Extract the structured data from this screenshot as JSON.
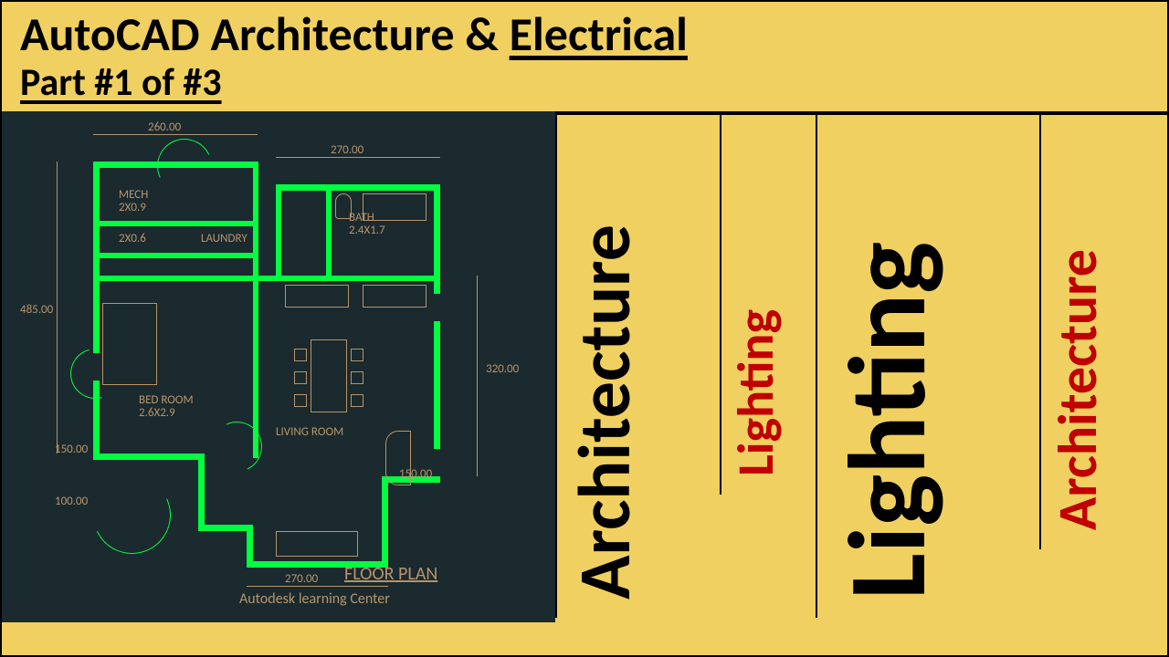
{
  "header": {
    "title_prefix": "AutoCAD Architecture & ",
    "title_underlined": "Electrical",
    "subtitle": "Part #1 of #3"
  },
  "cards": [
    {
      "label": "Architecture",
      "color": "black",
      "size": "large"
    },
    {
      "label": "Lighting",
      "color": "red",
      "size": "small"
    },
    {
      "label": "Lighting",
      "color": "black",
      "size": "xlarge"
    },
    {
      "label": "Architecture",
      "color": "red",
      "size": "medium"
    }
  ],
  "floorplan": {
    "title": "FLOOR PLAN",
    "subtitle": "Autodesk learning Center",
    "rooms": {
      "mech": {
        "label": "MECH",
        "size": "2X0.9"
      },
      "mech2": {
        "size": "2X0.6"
      },
      "laundry": {
        "label": "LAUNDRY"
      },
      "bath": {
        "label": "BATH",
        "size": "2.4X1.7"
      },
      "bedroom": {
        "label": "BED ROOM",
        "size": "2.6X2.9"
      },
      "living": {
        "label": "LIVING ROOM"
      }
    },
    "dimensions": {
      "top_left": "260.00",
      "top_right": "270.00",
      "left": "485.00",
      "right": "320.00",
      "mid_left": "150.00",
      "bottom_far_left": "100.00",
      "bottom_right": "150.00",
      "bottom": "270.00"
    }
  }
}
